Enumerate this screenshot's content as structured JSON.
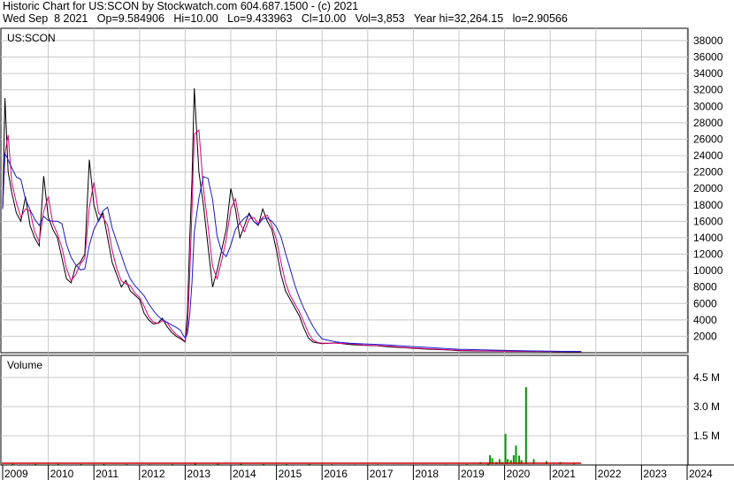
{
  "header": {
    "line1": "Historic Chart for US:SCON by Stockwatch.com 604.687.1500 - (c) 2021",
    "line2": "Wed Sep  8 2021   Op=9.584906   Hi=10.00   Lo=9.433963   Cl=10.00   Vol=3,853   Year hi=32,264.15   lo=2.90566"
  },
  "colors": {
    "grid": "#c8c8c8",
    "price": "#000000",
    "ma_short": "#e0007a",
    "ma_long": "#1a1acc",
    "volume_up": "#009900",
    "volume_down": "#cc0000"
  },
  "chart_data": [
    {
      "type": "line",
      "title": "US:SCON",
      "ylim": [
        0,
        39500
      ],
      "y_ticks": [
        "2000",
        "4000",
        "6000",
        "8000",
        "10000",
        "12000",
        "14000",
        "16000",
        "18000",
        "20000",
        "22000",
        "24000",
        "26000",
        "28000",
        "30000",
        "32000",
        "34000",
        "36000",
        "38000"
      ],
      "series": [
        {
          "x": [
            2009.0,
            2009.05,
            2009.12,
            2009.2,
            2009.3,
            2009.4,
            2009.5,
            2009.6,
            2009.7,
            2009.8,
            2009.9,
            2010.0,
            2010.1,
            2010.2,
            2010.3,
            2010.4,
            2010.5,
            2010.6,
            2010.7,
            2010.8,
            2010.9,
            2011.0,
            2011.1,
            2011.2,
            2011.3,
            2011.4,
            2011.5,
            2011.6,
            2011.7,
            2011.8,
            2011.9,
            2012.0,
            2012.1,
            2012.2,
            2012.3,
            2012.4,
            2012.5,
            2012.6,
            2012.7,
            2012.8,
            2012.9,
            2012.95,
            2013.0,
            2013.05,
            2013.1,
            2013.15,
            2013.2,
            2013.3,
            2013.4,
            2013.5,
            2013.6,
            2013.7,
            2013.8,
            2013.9,
            2014.0,
            2014.1,
            2014.2,
            2014.3,
            2014.4,
            2014.5,
            2014.6,
            2014.7,
            2014.8,
            2014.9,
            2015.0,
            2015.1,
            2015.2,
            2015.3,
            2015.4,
            2015.5,
            2015.6,
            2015.7,
            2015.8,
            2015.9,
            2016.0,
            2016.3,
            2016.6,
            2016.9,
            2017.2,
            2017.5,
            2017.8,
            2018.1,
            2018.4,
            2018.7,
            2019.0,
            2019.5,
            2020.0,
            2020.5,
            2021.0,
            2021.3,
            2021.68
          ],
          "values": [
            17500,
            31000,
            22000,
            19500,
            17000,
            16000,
            19000,
            15500,
            14000,
            13000,
            21500,
            16500,
            15000,
            14000,
            11500,
            9000,
            8500,
            10500,
            11000,
            12000,
            23500,
            18000,
            16000,
            17000,
            14000,
            11000,
            9500,
            8000,
            8800,
            7500,
            7000,
            6500,
            4800,
            4000,
            3500,
            3600,
            4200,
            3200,
            2500,
            2000,
            1700,
            1500,
            1300,
            5000,
            14000,
            21000,
            32200,
            22000,
            18000,
            13000,
            8000,
            10000,
            12500,
            15000,
            20000,
            17500,
            14000,
            15500,
            17000,
            16000,
            15500,
            17500,
            16000,
            15000,
            12500,
            9500,
            7500,
            6500,
            5500,
            4500,
            3000,
            1800,
            1300,
            1200,
            1100,
            1200,
            1000,
            900,
            850,
            700,
            600,
            500,
            400,
            350,
            250,
            200,
            180,
            160,
            150,
            140,
            130
          ],
          "name": ""
        }
      ]
    },
    {
      "type": "bar",
      "title": "Volume",
      "ylim": [
        0,
        5000000
      ],
      "y_ticks": [
        "1.5 M",
        "3.0 M",
        "4.5 M"
      ],
      "x": [
        2009.2,
        2009.7,
        2010.2,
        2010.7,
        2011.2,
        2011.7,
        2012.2,
        2012.7,
        2013.2,
        2013.7,
        2014.2,
        2014.7,
        2015.2,
        2015.7,
        2016.2,
        2016.7,
        2017.2,
        2017.7,
        2018.2,
        2018.7,
        2019.15,
        2019.45,
        2019.62,
        2019.66,
        2019.71,
        2019.8,
        2019.87,
        2019.93,
        2020.0,
        2020.05,
        2020.12,
        2020.18,
        2020.23,
        2020.3,
        2020.35,
        2020.45,
        2020.62,
        2020.9,
        2021.2,
        2021.5
      ],
      "values": [
        60000,
        50000,
        55000,
        45000,
        50000,
        40000,
        35000,
        40000,
        70000,
        60000,
        55000,
        50000,
        40000,
        45000,
        35000,
        30000,
        30000,
        25000,
        25000,
        30000,
        40000,
        150000,
        60000,
        500000,
        350000,
        160000,
        300000,
        150000,
        1600000,
        300000,
        250000,
        500000,
        1000000,
        480000,
        250000,
        4000000,
        300000,
        200000,
        150000,
        80000
      ]
    }
  ],
  "x_axis": {
    "labels": [
      "2009",
      "2010",
      "2011",
      "2012",
      "2013",
      "2014",
      "2015",
      "2016",
      "2017",
      "2018",
      "2019",
      "2020",
      "2021",
      "2022",
      "2023",
      "2024"
    ]
  }
}
